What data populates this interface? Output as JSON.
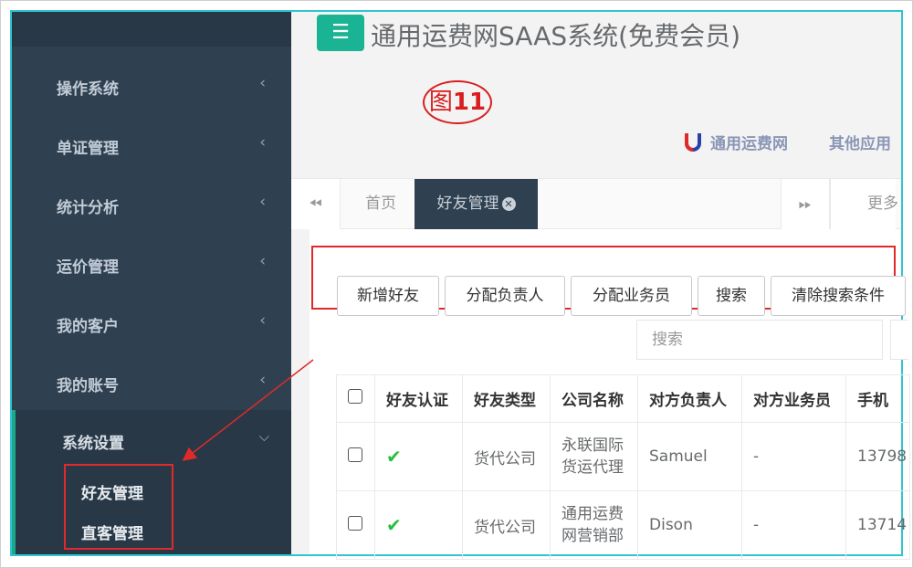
{
  "app": {
    "title": "通用运费网SAAS系统(免费会员)",
    "figure_label_prefix": "图",
    "figure_label_number": "11",
    "brand_name": "通用运费网",
    "other_apps": "其他应用"
  },
  "sidebar": {
    "items": [
      {
        "label": "操作系统"
      },
      {
        "label": "单证管理"
      },
      {
        "label": "统计分析"
      },
      {
        "label": "运价管理"
      },
      {
        "label": "我的客户"
      },
      {
        "label": "我的账号"
      }
    ],
    "active_group": {
      "label": "系统设置",
      "sub_items": [
        {
          "label": "好友管理"
        },
        {
          "label": "直客管理"
        }
      ]
    }
  },
  "tabs": {
    "home": "首页",
    "active": "好友管理",
    "more": "更多"
  },
  "toolbar": {
    "buttons": [
      {
        "label": "新增好友"
      },
      {
        "label": "分配负责人"
      },
      {
        "label": "分配业务员"
      },
      {
        "label": "搜索"
      },
      {
        "label": "清除搜索条件"
      }
    ],
    "search_placeholder": "搜索"
  },
  "table": {
    "columns": [
      "好友认证",
      "好友类型",
      "公司名称",
      "对方负责人",
      "对方业务员",
      "手机"
    ],
    "rows": [
      {
        "verified": true,
        "type": "货代公司",
        "company": "永联国际货运代理",
        "contact": "Samuel",
        "sales": "-",
        "phone": "13798"
      },
      {
        "verified": true,
        "type": "货代公司",
        "company": "通用运费网营销部",
        "contact": "Dison",
        "sales": "-",
        "phone": "13714"
      }
    ]
  },
  "colors": {
    "sidebar_bg": "#2f4050",
    "accent": "#1ab394",
    "annotation": "#e02a2a",
    "link": "#337ab7",
    "check": "#22c13f"
  }
}
